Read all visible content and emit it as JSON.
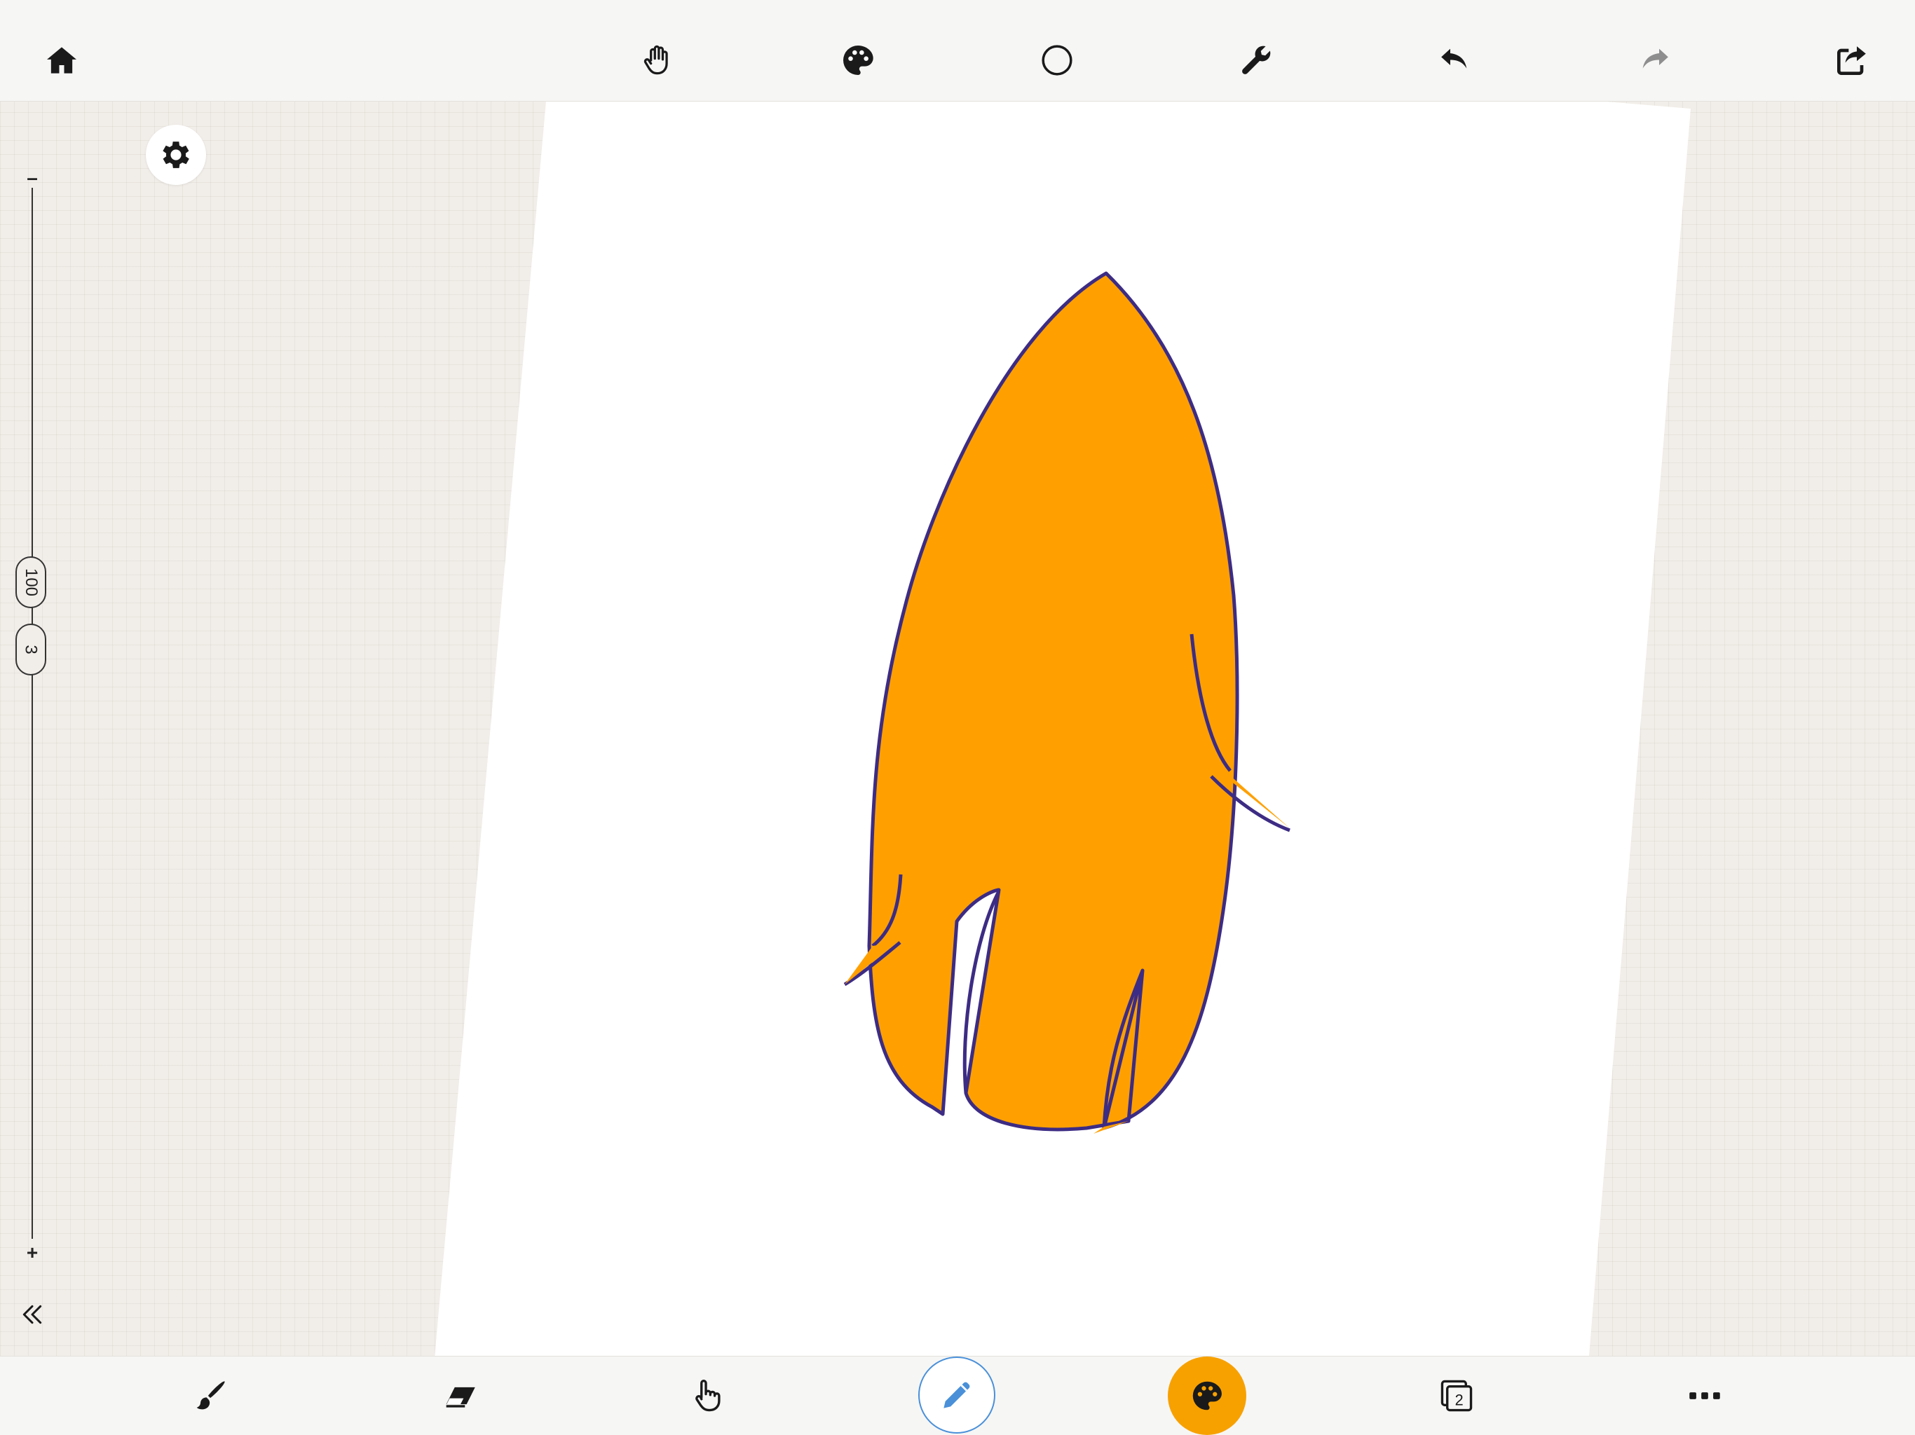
{
  "toolbar_top": {
    "icons": [
      "home-icon",
      "hand-icon",
      "palette-icon",
      "circle-shape-icon",
      "wrench-icon",
      "undo-icon",
      "redo-icon",
      "share-icon"
    ]
  },
  "side_panel": {
    "slider_min_label": "–",
    "slider_max_label": "+",
    "brush_size": "100",
    "brush_opacity": "3"
  },
  "toolbar_bottom": {
    "icons": [
      "brush-icon",
      "eraser-icon",
      "finger-icon",
      "pencil-icon",
      "color-palette-icon",
      "layers-icon",
      "more-icon"
    ],
    "layer_count": "2"
  },
  "colors": {
    "accent_active_tool": "#4a90d9",
    "current_color": "#f7a100",
    "fill_orange": "#ffa000",
    "stroke_purple": "#3d2c84"
  }
}
